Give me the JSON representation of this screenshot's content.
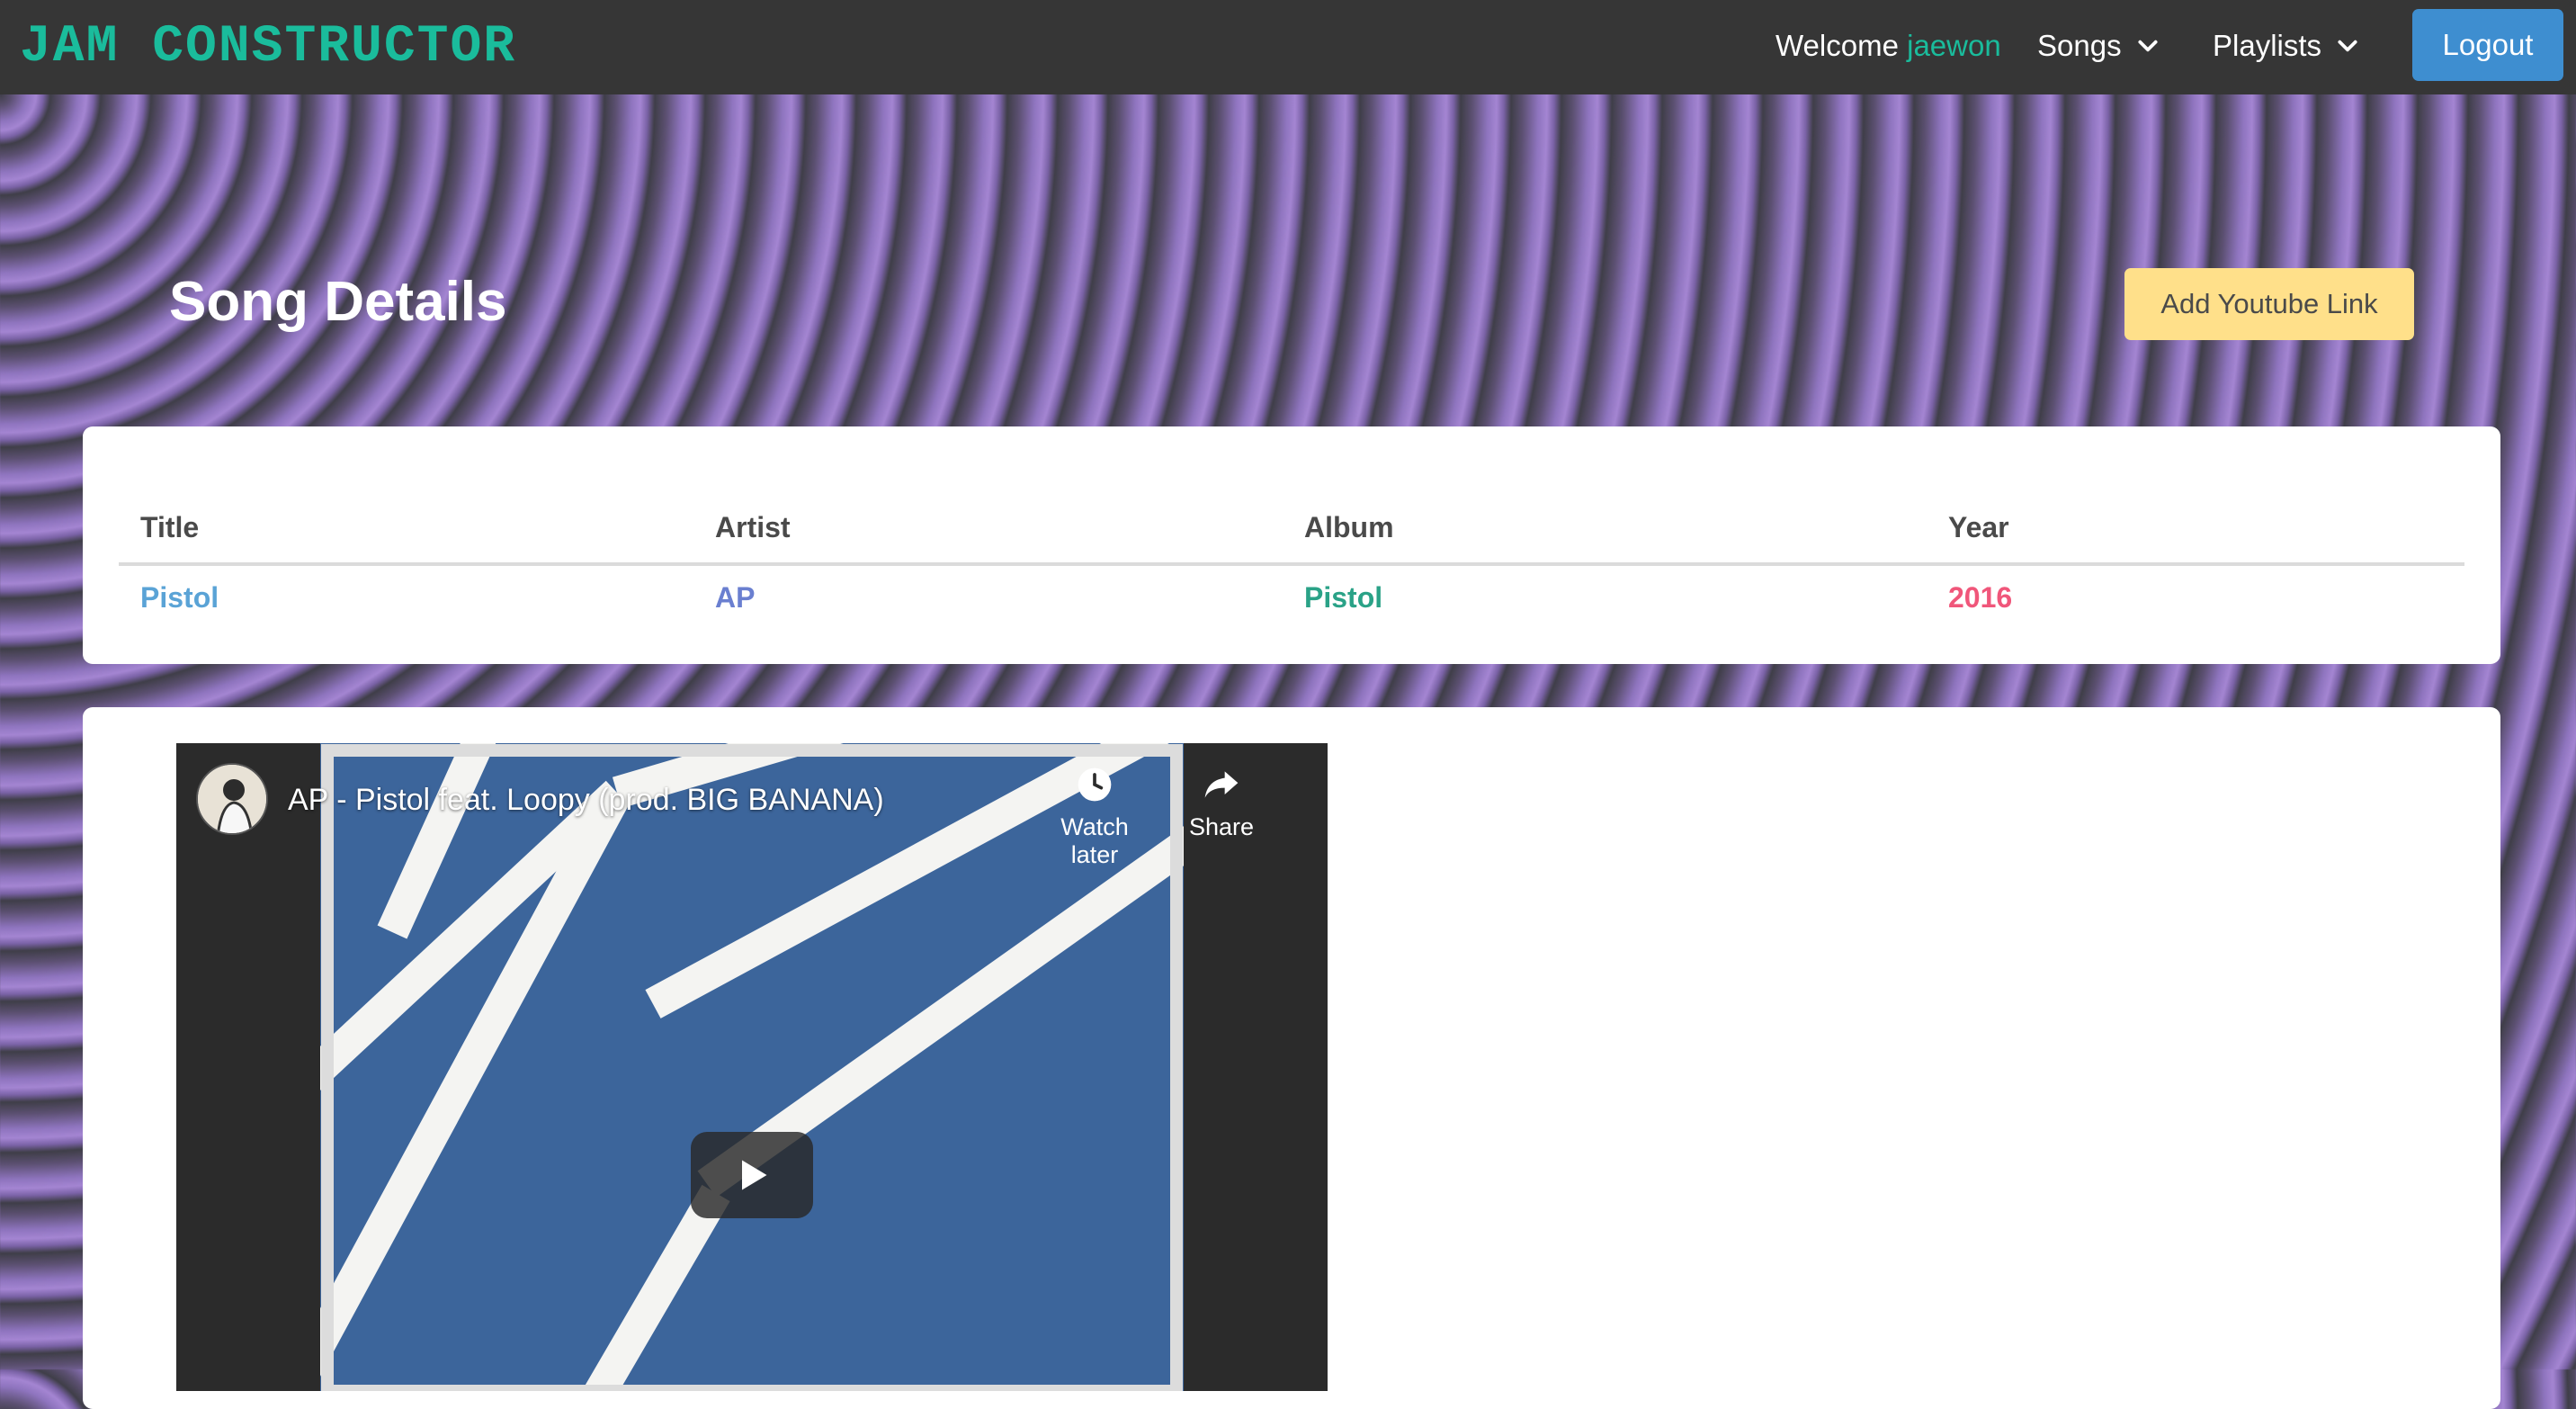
{
  "navbar": {
    "brand": "JAM CONSTRUCTOR",
    "welcome_prefix": "Welcome",
    "username": "jaewon",
    "songs_label": "Songs",
    "playlists_label": "Playlists",
    "logout_label": "Logout",
    "chevron_icon": "chevron-down-icon"
  },
  "page": {
    "title": "Song Details",
    "add_youtube_label": "Add Youtube Link"
  },
  "table": {
    "headers": [
      "Title",
      "Artist",
      "Album",
      "Year"
    ],
    "rows": [
      [
        "Pistol",
        "AP",
        "Pistol",
        "2016"
      ]
    ]
  },
  "video": {
    "title": "AP - Pistol feat. Loopy (prod. BIG BANANA)",
    "watch_later_label": "Watch later",
    "share_label": "Share",
    "icons": [
      "clock-icon",
      "share-icon",
      "play-icon",
      "channel-avatar"
    ]
  },
  "colors": {
    "brand": "#1abc9c",
    "navbar_bg": "#363636",
    "logout_bg": "#3e8ed0",
    "add_link_bg": "#ffe08a",
    "title_link": "#5aa3d6",
    "artist_link": "#6a7fd0",
    "album_link": "#2aa287",
    "year_link": "#f0567a"
  }
}
